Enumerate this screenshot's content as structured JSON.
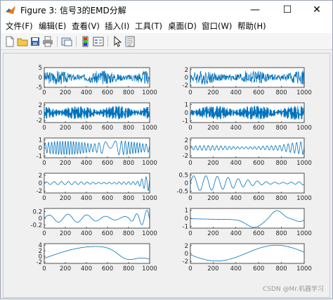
{
  "window": {
    "title": "Figure 3: 信号3的EMD分解",
    "minimize_glyph": "—",
    "maximize_glyph": "☐",
    "close_glyph": "✕"
  },
  "menu": [
    {
      "id": "file",
      "label": "文件(F)"
    },
    {
      "id": "edit",
      "label": "编辑(E)"
    },
    {
      "id": "view",
      "label": "查看(V)"
    },
    {
      "id": "insert",
      "label": "插入(I)"
    },
    {
      "id": "tools",
      "label": "工具(T)"
    },
    {
      "id": "desktop",
      "label": "桌面(D)"
    },
    {
      "id": "window",
      "label": "窗口(W)"
    },
    {
      "id": "help",
      "label": "帮助(H)"
    }
  ],
  "toolbar": [
    "new-figure-icon",
    "open-icon",
    "save-icon",
    "print-icon",
    "link-plot-icon",
    "colorbar-icon",
    "legend-icon",
    "cursor-icon",
    "property-inspector-icon"
  ],
  "chart_data": [
    {
      "type": "line",
      "panel": "left-1",
      "xlim": [
        0,
        1000
      ],
      "yticks": [
        "5",
        "0",
        "-5"
      ],
      "ylim": [
        -5,
        5
      ],
      "xticks": [
        "0",
        "200",
        "400",
        "600",
        "800",
        "1000"
      ],
      "series": [
        {
          "signal": "noise",
          "amplitude": 4
        }
      ]
    },
    {
      "type": "line",
      "panel": "right-1",
      "xlim": [
        0,
        1000
      ],
      "yticks": [
        "2",
        "0",
        "-2"
      ],
      "ylim": [
        -2.5,
        2.5
      ],
      "xticks": [
        "0",
        "200",
        "400",
        "600",
        "800",
        "1000"
      ],
      "series": [
        {
          "signal": "noise",
          "amplitude": 2
        }
      ]
    },
    {
      "type": "line",
      "panel": "left-2",
      "xlim": [
        0,
        1000
      ],
      "yticks": [
        "2",
        "0",
        "-2"
      ],
      "ylim": [
        -2.5,
        2.5
      ],
      "xticks": [
        "0",
        "200",
        "400",
        "600",
        "800",
        "1000"
      ],
      "series": [
        {
          "signal": "bursts",
          "amplitude": 2
        }
      ]
    },
    {
      "type": "line",
      "panel": "right-2",
      "xlim": [
        0,
        1000
      ],
      "yticks": [
        "1",
        "0",
        "-1"
      ],
      "ylim": [
        -1.2,
        1.2
      ],
      "xticks": [
        "0",
        "200",
        "400",
        "600",
        "800",
        "1000"
      ],
      "series": [
        {
          "signal": "bursts",
          "amplitude": 1
        }
      ]
    },
    {
      "type": "line",
      "panel": "left-3",
      "xlim": [
        0,
        1000
      ],
      "yticks": [
        "1",
        "0",
        "-1"
      ],
      "ylim": [
        -1.2,
        1.2
      ],
      "xticks": [
        "0",
        "200",
        "400",
        "600",
        "800",
        "1000"
      ],
      "series": [
        {
          "signal": "chirp",
          "amplitude": 1
        }
      ]
    },
    {
      "type": "line",
      "panel": "right-3",
      "xlim": [
        0,
        1000
      ],
      "yticks": [
        "2",
        "0",
        "-2"
      ],
      "ylim": [
        -2.5,
        2.5
      ],
      "xticks": [
        "0",
        "200",
        "400",
        "600",
        "800",
        "1000"
      ],
      "series": [
        {
          "signal": "growing-tail",
          "amplitude": 2
        }
      ]
    },
    {
      "type": "line",
      "panel": "left-4",
      "xlim": [
        0,
        1000
      ],
      "yticks": [
        "2",
        "0",
        "-2"
      ],
      "ylim": [
        -2.5,
        2.5
      ],
      "xticks": [
        "0",
        "200",
        "400",
        "600",
        "800",
        "1000"
      ],
      "series": [
        {
          "signal": "small-with-tail",
          "amplitude": 2
        }
      ]
    },
    {
      "type": "line",
      "panel": "right-4",
      "xlim": [
        0,
        1000
      ],
      "yticks": [
        "0.5",
        "0",
        "-0.5"
      ],
      "ylim": [
        -0.6,
        0.6
      ],
      "xticks": [
        "0",
        "200",
        "400",
        "600",
        "800",
        "1000"
      ],
      "series": [
        {
          "signal": "mid-oscillation",
          "amplitude": 0.45
        }
      ]
    },
    {
      "type": "line",
      "panel": "left-5",
      "xlim": [
        0,
        1000
      ],
      "yticks": [
        "0.2",
        "0",
        "-0.2"
      ],
      "ylim": [
        -0.3,
        0.3
      ],
      "xticks": [
        "0",
        "200",
        "400",
        "600",
        "800",
        "1000"
      ],
      "series": [
        {
          "signal": "slow-wave-tail",
          "amplitude": 0.25
        }
      ]
    },
    {
      "type": "line",
      "panel": "right-5",
      "xlim": [
        0,
        1000
      ],
      "yticks": [
        "1",
        "0",
        "-1"
      ],
      "ylim": [
        -1.2,
        1.2
      ],
      "xticks": [
        "0",
        "200",
        "400",
        "600",
        "800",
        "1000"
      ],
      "series": [
        {
          "signal": "single-hump",
          "amplitude": 1
        }
      ]
    },
    {
      "type": "line",
      "panel": "left-6",
      "xlim": [
        0,
        1000
      ],
      "yticks": [
        "4",
        "2",
        "0",
        "-2"
      ],
      "ylim": [
        -2.5,
        4.5
      ],
      "xticks": [
        "0",
        "200",
        "400",
        "600",
        "800",
        "1000"
      ],
      "series": [
        {
          "signal": "trend-arch",
          "amplitude": 3.5
        }
      ]
    },
    {
      "type": "line",
      "panel": "right-6",
      "xlim": [
        0,
        1000
      ],
      "yticks": [
        "2",
        "0",
        "-2"
      ],
      "ylim": [
        -2.5,
        2.5
      ],
      "xticks": [
        "0",
        "200",
        "400",
        "600",
        "800",
        "1000"
      ],
      "series": [
        {
          "signal": "trend-valley",
          "amplitude": 2
        }
      ]
    }
  ],
  "colors": {
    "line": "#0072bd",
    "axes": "#262626",
    "canvas": "#f0f0f0"
  },
  "watermark": "CSDN @Mr.机器学习"
}
